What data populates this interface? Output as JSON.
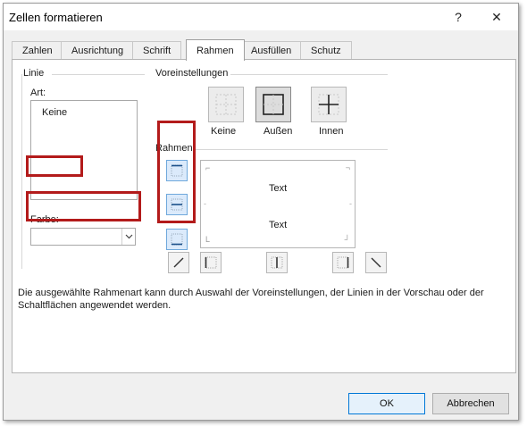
{
  "window": {
    "title": "Zellen formatieren",
    "help": "?",
    "close": "✕"
  },
  "tabs": [
    {
      "label": "Zahlen"
    },
    {
      "label": "Ausrichtung"
    },
    {
      "label": "Schrift"
    },
    {
      "label": "Rahmen"
    },
    {
      "label": "Ausfüllen"
    },
    {
      "label": "Schutz"
    }
  ],
  "line": {
    "group": "Linie",
    "style_label": "Art:",
    "none_option": "Keine",
    "color_label": "Farbe:"
  },
  "presets": {
    "group": "Voreinstellungen",
    "none": "Keine",
    "outline": "Außen",
    "inside": "Innen"
  },
  "border": {
    "group": "Rahmen"
  },
  "preview": {
    "text_top": "Text",
    "text_bottom": "Text"
  },
  "hint": "Die ausgewählte Rahmenart kann durch Auswahl der Voreinstellungen, der Linien in der Vorschau oder der Schaltflächen angewendet werden.",
  "buttons": {
    "ok": "OK",
    "cancel": "Abbrechen"
  },
  "colors": {
    "highlight": "#b31b1b",
    "accent": "#0078d7"
  }
}
